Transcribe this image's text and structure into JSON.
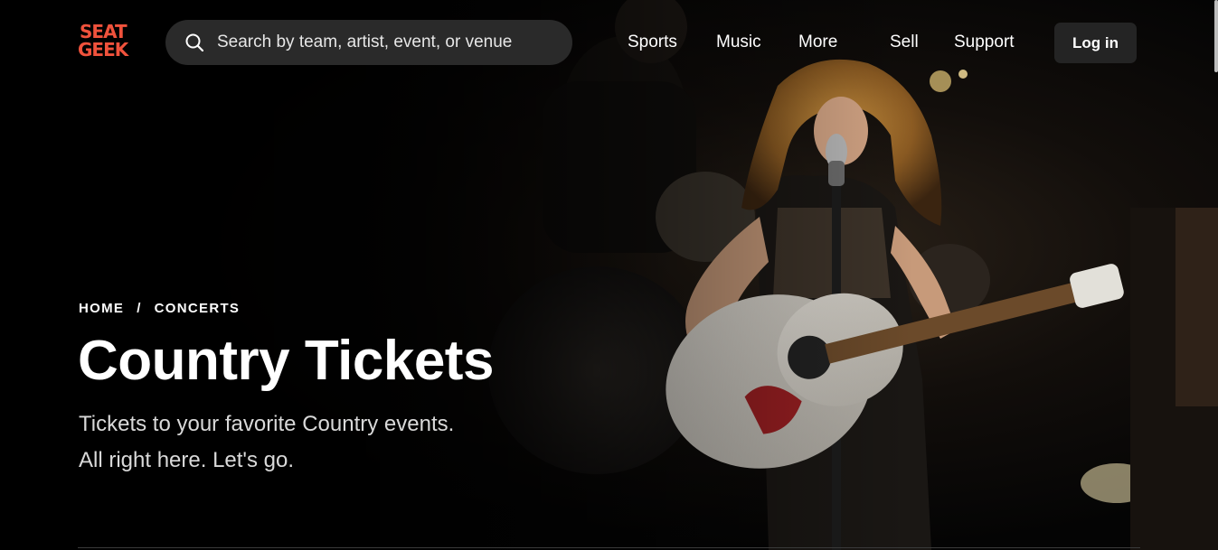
{
  "brand": {
    "logo_line1": "SEAT",
    "logo_line2": "GEEK",
    "logo_color": "#f0523c"
  },
  "search": {
    "placeholder": "Search by team, artist, event, or venue",
    "value": "",
    "icon": "search-icon"
  },
  "nav": {
    "items": [
      {
        "label": "Sports"
      },
      {
        "label": "Music"
      },
      {
        "label": "More"
      },
      {
        "label": "Sell"
      },
      {
        "label": "Support"
      }
    ],
    "login_label": "Log in"
  },
  "hero": {
    "breadcrumb": [
      "HOME",
      "CONCERTS"
    ],
    "breadcrumb_separator": "/",
    "title": "Country Tickets",
    "subtitle_line1": "Tickets to your favorite Country events.",
    "subtitle_line2": "All right here. Let's go.",
    "image": "hero-photo"
  },
  "colors": {
    "background": "#050505",
    "search_bg": "#2a2a2a",
    "login_bg": "#242424",
    "text": "#ffffff"
  }
}
